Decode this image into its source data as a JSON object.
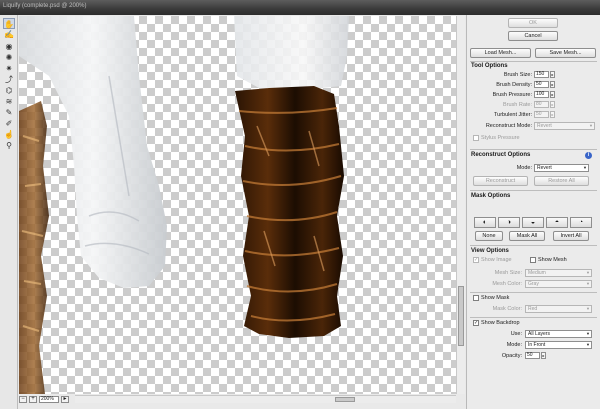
{
  "window": {
    "title": "Liquify (complete.psd @ 200%)"
  },
  "toolbox": {
    "tools": [
      {
        "name": "forward-warp-tool",
        "glyph": "✋"
      },
      {
        "name": "reconstruct-tool",
        "glyph": "✍"
      },
      {
        "name": "twirl-tool",
        "glyph": "◉"
      },
      {
        "name": "pucker-tool",
        "glyph": "✺"
      },
      {
        "name": "bloat-tool",
        "glyph": "✷"
      },
      {
        "name": "push-left-tool",
        "glyph": "⤴"
      },
      {
        "name": "mirror-tool",
        "glyph": "⌬"
      },
      {
        "name": "turbulence-tool",
        "glyph": "≋"
      },
      {
        "name": "freeze-mask-tool",
        "glyph": "✎"
      },
      {
        "name": "thaw-mask-tool",
        "glyph": "✐"
      },
      {
        "name": "hand-tool",
        "glyph": "☝"
      },
      {
        "name": "zoom-tool",
        "glyph": "⚲"
      }
    ]
  },
  "status": {
    "zoom_value": "200%",
    "minus": "−",
    "plus": "+"
  },
  "buttons": {
    "ok": "OK",
    "cancel": "Cancel",
    "load_mesh": "Load Mesh...",
    "save_mesh": "Save Mesh..."
  },
  "tool_options": {
    "heading": "Tool Options",
    "brush_size_label": "Brush Size:",
    "brush_size": "150",
    "brush_density_label": "Brush Density:",
    "brush_density": "50",
    "brush_pressure_label": "Brush Pressure:",
    "brush_pressure": "100",
    "brush_rate_label": "Brush Rate:",
    "brush_rate": "80",
    "turbulent_jitter_label": "Turbulent Jitter:",
    "turbulent_jitter": "50",
    "reconstruct_mode_label": "Reconstruct Mode:",
    "reconstruct_mode": "Revert",
    "stylus_pressure_label": "Stylus Pressure"
  },
  "reconstruct_options": {
    "heading": "Reconstruct Options",
    "mode_label": "Mode:",
    "mode": "Revert",
    "reconstruct_button": "Reconstruct",
    "restore_all_button": "Restore All"
  },
  "mask_options": {
    "heading": "Mask Options",
    "none_button": "None",
    "mask_all_button": "Mask All",
    "invert_all_button": "Invert All"
  },
  "view_options": {
    "heading": "View Options",
    "show_image_label": "Show Image",
    "show_mesh_label": "Show Mesh",
    "mesh_size_label": "Mesh Size:",
    "mesh_size": "Medium",
    "mesh_color_label": "Mesh Color:",
    "mesh_color": "Gray",
    "show_mask_label": "Show Mask",
    "mask_color_label": "Mask Color:",
    "mask_color": "Red",
    "show_backdrop_label": "Show Backdrop",
    "use_label": "Use:",
    "use": "All Layers",
    "mode_label": "Mode:",
    "mode": "In Front",
    "opacity_label": "Opacity:",
    "opacity": "50"
  },
  "colors": {
    "accent": "#3864c8",
    "panel_bg": "#ebebeb",
    "title_bar": "#3a3a3a"
  }
}
